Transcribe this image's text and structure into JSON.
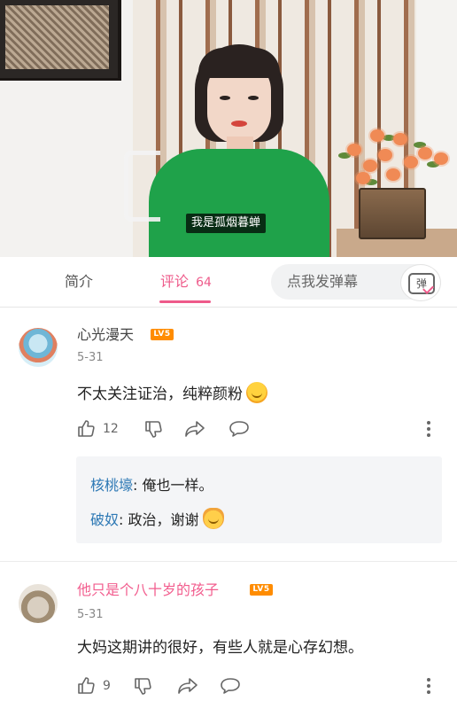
{
  "video": {
    "subtitle": "我是孤烟暮蝉"
  },
  "tabs": {
    "intro_label": "简介",
    "comments_label": "评论",
    "comments_count": "64",
    "danmaku_placeholder": "点我发弹幕",
    "danmaku_icon_text": "弹"
  },
  "comments": [
    {
      "username": "心光漫天",
      "level": "LV5",
      "date": "5-31",
      "text": "不太关注证治，纯粹颜粉",
      "likes": "12",
      "replies": [
        {
          "name": "核桃壕",
          "text": "俺也一样。"
        },
        {
          "name": "破奴",
          "text": "政治，谢谢"
        }
      ]
    },
    {
      "username": "他只是个八十岁的孩子",
      "level": "LV5",
      "date": "5-31",
      "text": "大妈这期讲的很好，有些人就是心存幻想。",
      "likes": "9"
    }
  ],
  "colors": {
    "accent_pink": "#ee5a8a",
    "level_badge": "#ff8c00",
    "reply_name": "#2e79b5"
  }
}
